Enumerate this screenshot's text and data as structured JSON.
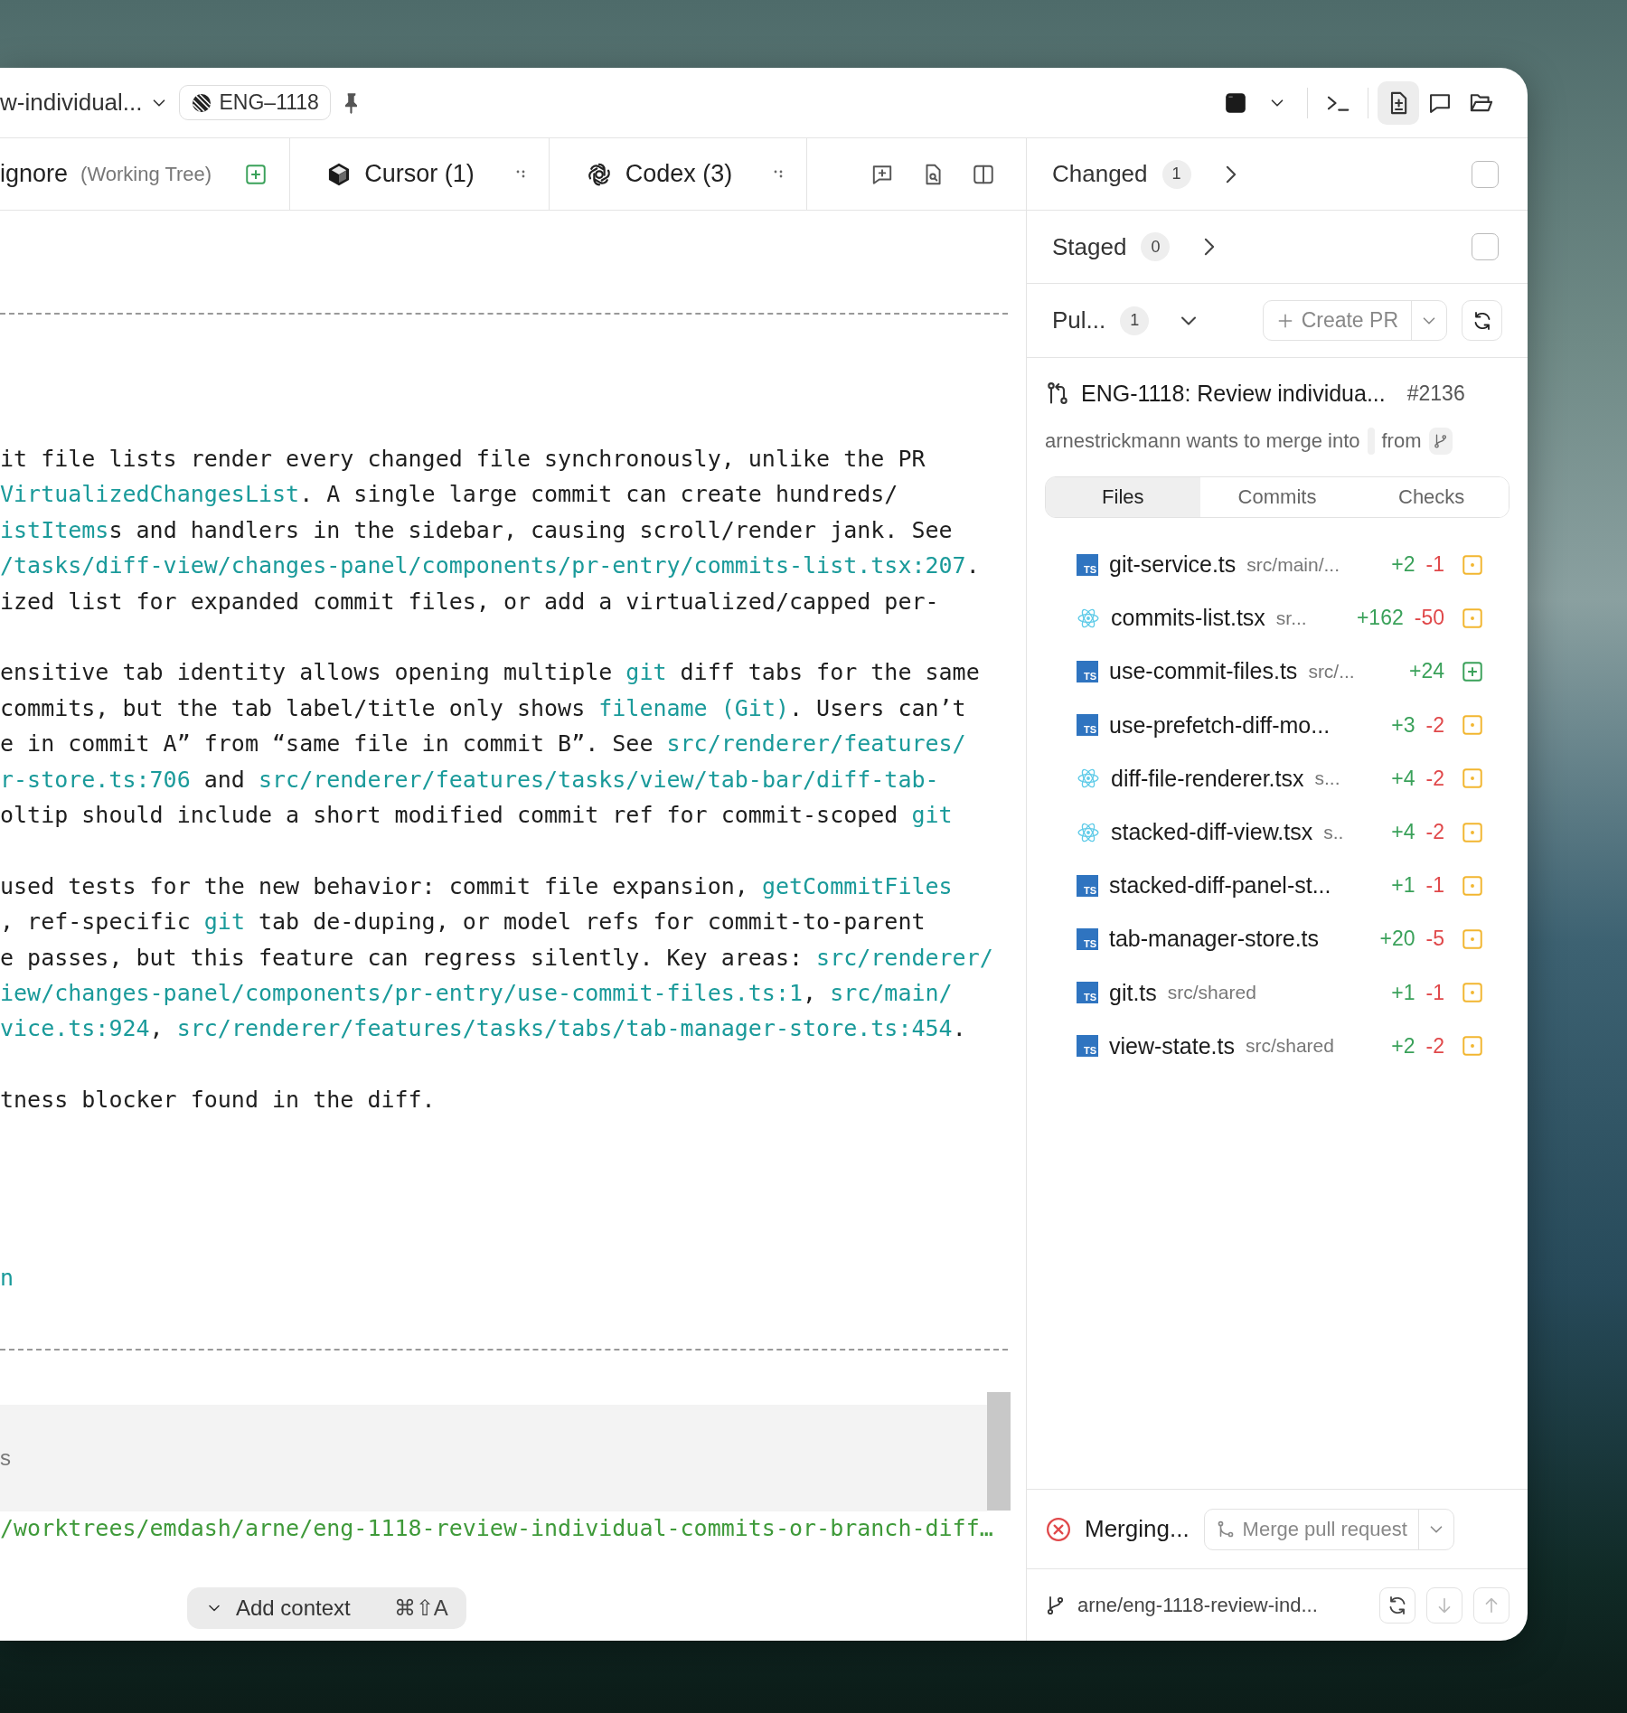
{
  "title_bar": {
    "branch": "w-individual...",
    "issue_chip": "ENG–1118"
  },
  "tabs": [
    {
      "kind": "file",
      "label": "ignore",
      "note": "(Working Tree)"
    },
    {
      "kind": "cursor",
      "label": "Cursor (1)"
    },
    {
      "kind": "codex",
      "label": "Codex (3)"
    }
  ],
  "message": {
    "paragraphs": [
      {
        "lines": [
          [
            {
              "kind": "text",
              "text": "it file lists render every changed file synchronously, unlike the PR"
            }
          ],
          [
            {
              "kind": "code",
              "text": "VirtualizedChangesList"
            },
            {
              "kind": "text",
              "text": ". A single large commit can create hundreds/"
            }
          ],
          [
            {
              "kind": "code",
              "text": "istItems"
            },
            {
              "kind": "text",
              "text": "s and handlers in the sidebar, causing scroll/render jank. See"
            }
          ],
          [
            {
              "kind": "link",
              "text": "/tasks/diff-view/changes-panel/components/pr-entry/commits-list.tsx:207"
            },
            {
              "kind": "text",
              "text": "."
            }
          ],
          [
            {
              "kind": "text",
              "text": "ized list for expanded commit files, or add a virtualized/capped per-"
            }
          ]
        ]
      },
      {
        "lines": [
          [
            {
              "kind": "text",
              "text": "ensitive tab identity allows opening multiple "
            },
            {
              "kind": "code",
              "text": "git"
            },
            {
              "kind": "text",
              "text": " diff tabs for the same"
            }
          ],
          [
            {
              "kind": "text",
              "text": "commits, but the tab label/title only shows "
            },
            {
              "kind": "code",
              "text": "filename (Git)"
            },
            {
              "kind": "text",
              "text": ". Users can’t"
            }
          ],
          [
            {
              "kind": "text",
              "text": "e in commit A” from “same file in commit B”. See "
            },
            {
              "kind": "link",
              "text": "src/renderer/features/"
            }
          ],
          [
            {
              "kind": "link",
              "text": "r-store.ts:706"
            },
            {
              "kind": "text",
              "text": " and "
            },
            {
              "kind": "link",
              "text": "src/renderer/features/tasks/view/tab-bar/diff-tab-"
            }
          ],
          [
            {
              "kind": "text",
              "text": "oltip should include a short modified commit ref for commit-scoped "
            },
            {
              "kind": "code",
              "text": "git"
            }
          ]
        ]
      },
      {
        "lines": [
          [
            {
              "kind": "text",
              "text": "used tests for the new behavior: commit file expansion, "
            },
            {
              "kind": "code",
              "text": "getCommitFiles"
            }
          ],
          [
            {
              "kind": "text",
              "text": ", ref-specific "
            },
            {
              "kind": "code",
              "text": "git"
            },
            {
              "kind": "text",
              "text": " tab de-duping, or model refs for commit-to-parent"
            }
          ],
          [
            {
              "kind": "text",
              "text": "e passes, but this feature can regress silently. Key areas: "
            },
            {
              "kind": "link",
              "text": "src/renderer/"
            }
          ],
          [
            {
              "kind": "link",
              "text": "iew/changes-panel/components/pr-entry/use-commit-files.ts:1"
            },
            {
              "kind": "text",
              "text": ", "
            },
            {
              "kind": "link",
              "text": "src/main/"
            }
          ],
          [
            {
              "kind": "link",
              "text": "vice.ts:924"
            },
            {
              "kind": "text",
              "text": ", "
            },
            {
              "kind": "link",
              "text": "src/renderer/features/tasks/tabs/tab-manager-store.ts:454"
            },
            {
              "kind": "text",
              "text": "."
            }
          ]
        ]
      },
      {
        "lines": [
          [
            {
              "kind": "text",
              "text": "tness blocker found in the diff."
            }
          ]
        ]
      }
    ],
    "trailing_link": "n"
  },
  "tool_output": {
    "label": "s",
    "path": "/worktrees/emdash/arne/eng-1118-review-individual-commits-or-branch-diff…"
  },
  "composer": {
    "add_context": "Add context",
    "shortcut": "⌘⇧A"
  },
  "sections": [
    {
      "label": "Changed",
      "count": "1",
      "checked": false
    },
    {
      "label": "Staged",
      "count": "0",
      "checked": false
    }
  ],
  "pull_requests": {
    "label": "Pul...",
    "count": "1",
    "create_button": "Create PR"
  },
  "pr": {
    "title": "ENG-1118: Review individua...",
    "number": "#2136",
    "meta": "arnestrickmann wants to merge into",
    "from": "from"
  },
  "pr_tabs": [
    {
      "label": "Files",
      "selected": true
    },
    {
      "label": "Commits",
      "selected": false
    },
    {
      "label": "Checks",
      "selected": false
    }
  ],
  "files": [
    {
      "kind": "ts",
      "icon_text": "TS",
      "name": "git-service.ts",
      "path": "src/main/...",
      "added": "+2",
      "removed": "-1",
      "new_file": false
    },
    {
      "kind": "react",
      "name": "commits-list.tsx",
      "path": "sr...",
      "added": "+162",
      "removed": "-50",
      "new_file": false
    },
    {
      "kind": "ts",
      "icon_text": "TS",
      "name": "use-commit-files.ts",
      "path": "src/...",
      "added": "+24",
      "new_file": true
    },
    {
      "kind": "ts",
      "icon_text": "TS",
      "name": "use-prefetch-diff-mo...",
      "added": "+3",
      "removed": "-2",
      "new_file": false
    },
    {
      "kind": "react",
      "name": "diff-file-renderer.tsx",
      "path": "s...",
      "added": "+4",
      "removed": "-2",
      "new_file": false
    },
    {
      "kind": "react",
      "name": "stacked-diff-view.tsx",
      "path": "s..",
      "added": "+4",
      "removed": "-2",
      "new_file": false
    },
    {
      "kind": "ts",
      "icon_text": "TS",
      "name": "stacked-diff-panel-st...",
      "added": "+1",
      "removed": "-1",
      "new_file": false
    },
    {
      "kind": "ts",
      "icon_text": "TS",
      "name": "tab-manager-store.ts",
      "added": "+20",
      "removed": "-5",
      "new_file": false
    },
    {
      "kind": "ts",
      "icon_text": "TS",
      "name": "git.ts",
      "path": "src/shared",
      "added": "+1",
      "removed": "-1",
      "new_file": false
    },
    {
      "kind": "ts",
      "icon_text": "TS",
      "name": "view-state.ts",
      "path": "src/shared",
      "added": "+2",
      "removed": "-2",
      "new_file": false
    }
  ],
  "merge": {
    "status": "Merging...",
    "button": "Merge pull request"
  },
  "branch": {
    "name": "arne/eng-1118-review-ind..."
  }
}
